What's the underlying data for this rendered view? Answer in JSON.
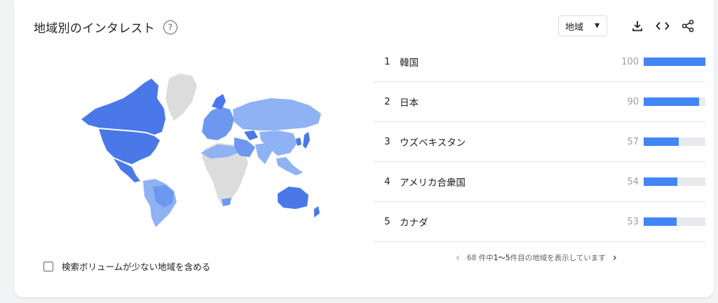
{
  "widget": {
    "title": "地域別のインタレスト",
    "region_select": "地域"
  },
  "colors": {
    "accent": "#4285f4",
    "map_dark": "#4a78e8",
    "map_light": "#8fb2f4",
    "map_none": "#dcdcdc"
  },
  "toolbar_icons": [
    "download-icon",
    "embed-icon",
    "share-icon"
  ],
  "ranking": [
    {
      "rank": "1",
      "name": "韓国",
      "value": "100",
      "level": 100
    },
    {
      "rank": "2",
      "name": "日本",
      "value": "90",
      "level": 90
    },
    {
      "rank": "3",
      "name": "ウズベキスタン",
      "value": "57",
      "level": 57
    },
    {
      "rank": "4",
      "name": "アメリカ合衆国",
      "value": "54",
      "level": 54
    },
    {
      "rank": "5",
      "name": "カナダ",
      "value": "53",
      "level": 53
    }
  ],
  "pagination": {
    "text_prefix": "68 件中 ",
    "range": "1〜5",
    "text_suffix": " 件目の地域を表示しています"
  },
  "low_volume_checkbox": {
    "label": "検索ボリュームが少ない地域を含める",
    "checked": false
  }
}
